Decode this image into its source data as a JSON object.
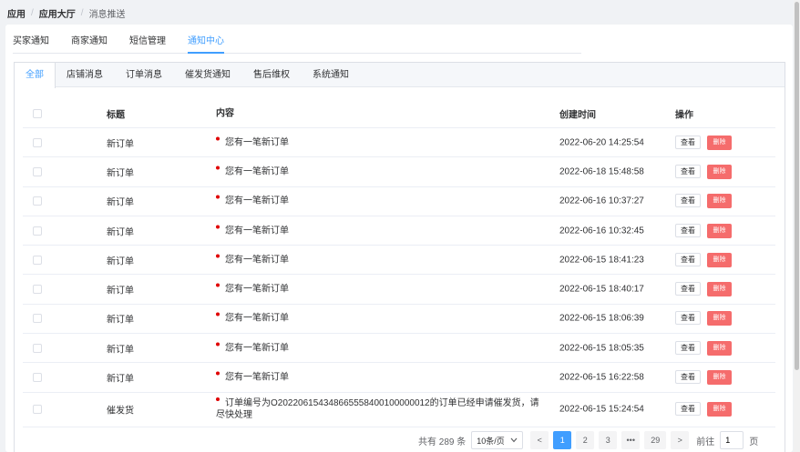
{
  "breadcrumb": {
    "root": "应用",
    "hall": "应用大厅",
    "current": "消息推送"
  },
  "top_tabs": [
    {
      "label": "买家通知",
      "active": false
    },
    {
      "label": "商家通知",
      "active": false
    },
    {
      "label": "短信管理",
      "active": false
    },
    {
      "label": "通知中心",
      "active": true
    }
  ],
  "sub_tabs": [
    {
      "label": "全部",
      "active": true
    },
    {
      "label": "店铺消息",
      "active": false
    },
    {
      "label": "订单消息",
      "active": false
    },
    {
      "label": "催发货通知",
      "active": false
    },
    {
      "label": "售后维权",
      "active": false
    },
    {
      "label": "系统通知",
      "active": false
    }
  ],
  "table": {
    "headers": {
      "title": "标题",
      "content": "内容",
      "time": "创建时间",
      "ops": "操作"
    },
    "view_label": "查看",
    "delete_label": "删除",
    "rows": [
      {
        "title": "新订单",
        "content": "您有一笔新订单",
        "time": "2022-06-20 14:25:54"
      },
      {
        "title": "新订单",
        "content": "您有一笔新订单",
        "time": "2022-06-18 15:48:58"
      },
      {
        "title": "新订单",
        "content": "您有一笔新订单",
        "time": "2022-06-16 10:37:27"
      },
      {
        "title": "新订单",
        "content": "您有一笔新订单",
        "time": "2022-06-16 10:32:45"
      },
      {
        "title": "新订单",
        "content": "您有一笔新订单",
        "time": "2022-06-15 18:41:23"
      },
      {
        "title": "新订单",
        "content": "您有一笔新订单",
        "time": "2022-06-15 18:40:17"
      },
      {
        "title": "新订单",
        "content": "您有一笔新订单",
        "time": "2022-06-15 18:06:39"
      },
      {
        "title": "新订单",
        "content": "您有一笔新订单",
        "time": "2022-06-15 18:05:35"
      },
      {
        "title": "新订单",
        "content": "您有一笔新订单",
        "time": "2022-06-15 16:22:58"
      },
      {
        "title": "催发货",
        "content": "订单编号为O20220615434866555840010000001​2的订单已经申请催发货，请尽快处理",
        "time": "2022-06-15 15:24:54"
      }
    ]
  },
  "pagination": {
    "total_text": "共有 289 条",
    "page_size": "10条/页",
    "prev": "<",
    "pages": [
      "1",
      "2",
      "3"
    ],
    "ellipsis": "•••",
    "last_page": "29",
    "next": ">",
    "goto_label": "前往",
    "goto_value": "1",
    "unit": "页"
  },
  "colors": {
    "accent": "#409eff",
    "danger": "#f56c6c",
    "unread_dot": "#e00000"
  }
}
